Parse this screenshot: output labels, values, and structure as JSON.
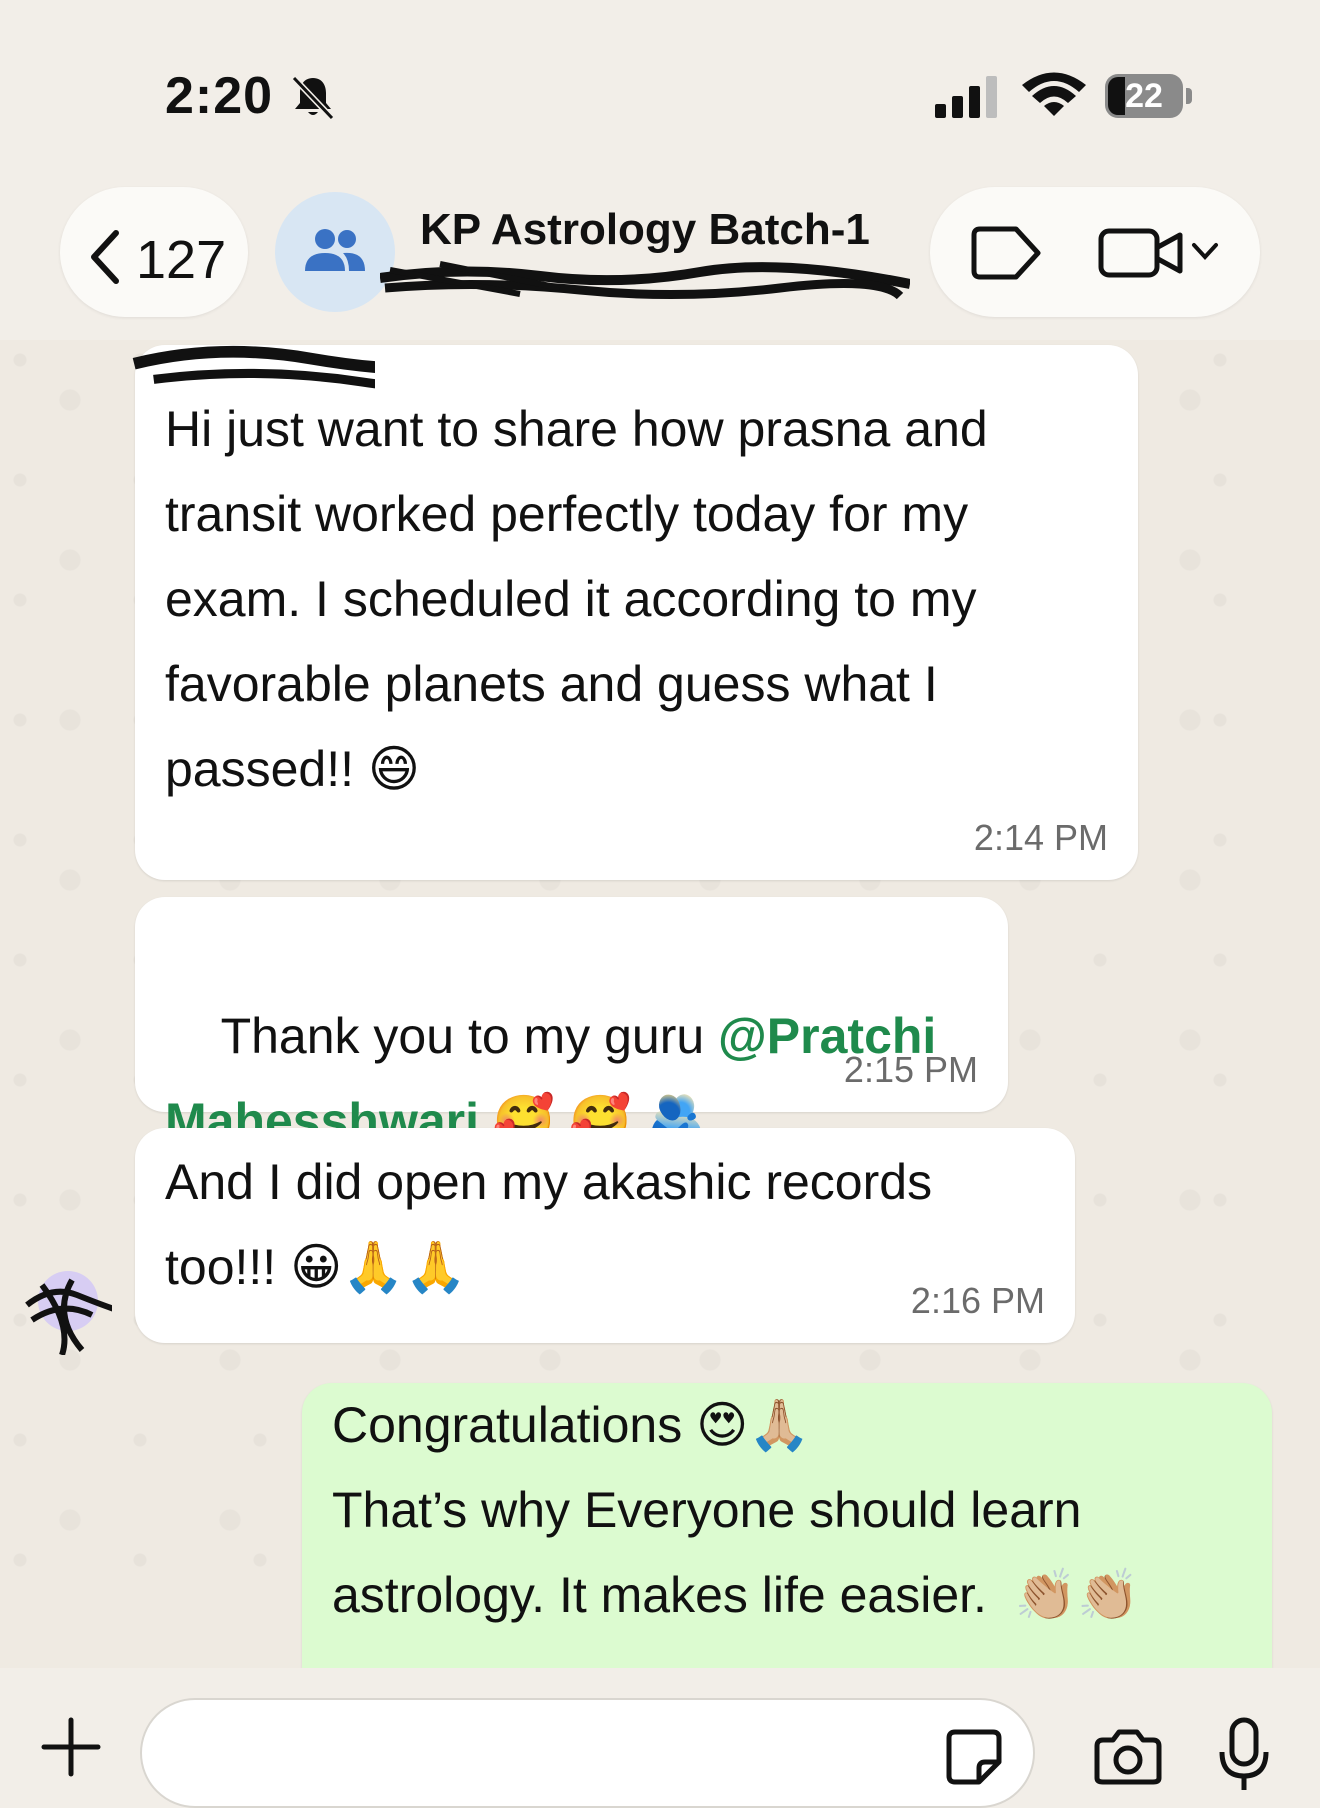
{
  "status_bar": {
    "time": "2:20",
    "battery": "22"
  },
  "header": {
    "back_count": "127",
    "group_title": "KP Astrology Batch-1"
  },
  "messages": [
    {
      "direction": "incoming",
      "text": "Hi just want to share how prasna and\ntransit worked perfectly today for my\nexam. I scheduled it according to my\nfavorable planets and guess what I\npassed!! 😄",
      "time": "2:14 PM"
    },
    {
      "direction": "incoming",
      "text_prefix": "Thank you to my guru ",
      "mention_line1": "@Pratchi",
      "mention_line2": "Mahesshwari",
      "text_suffix": " 🥰 🥰 🫂",
      "time": "2:15 PM"
    },
    {
      "direction": "incoming",
      "text": "And I did open my akashic records\ntoo!!! 😀🙏🙏",
      "time": "2:16 PM"
    },
    {
      "direction": "outgoing",
      "text": "Congratulations 😍🙏🏼\nThat’s why Everyone should learn\nastrology. It makes life easier.  👏🏼👏🏼"
    }
  ],
  "input": {
    "placeholder": ""
  },
  "colors": {
    "mention": "#1f8a4c",
    "outgoing_bubble": "#dcfbd0",
    "incoming_bubble": "#ffffff",
    "wallpaper": "#efeae2"
  }
}
